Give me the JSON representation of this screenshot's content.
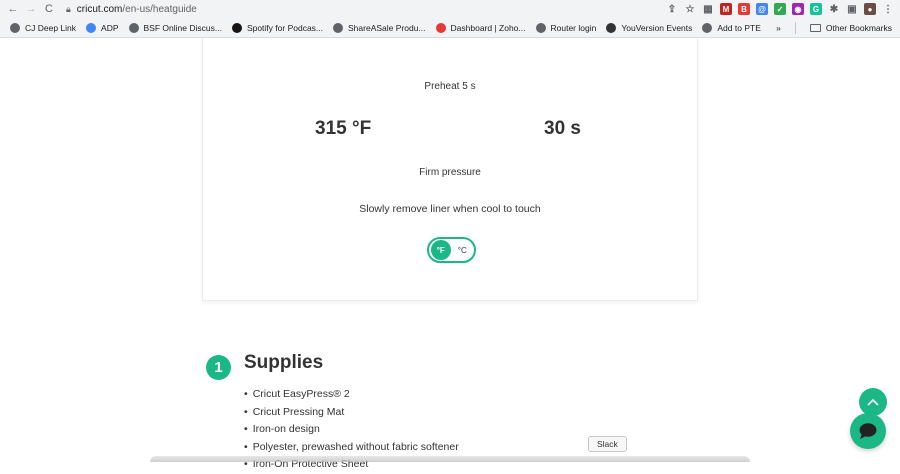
{
  "browser": {
    "url_host": "cricut.com",
    "url_path": "/en-us/heatguide",
    "nav": {
      "back": "←",
      "forward": "→",
      "reload": "C"
    },
    "extensions": [
      {
        "name": "share-icon",
        "glyph": "⇪",
        "color": "#5f6368"
      },
      {
        "name": "star-icon",
        "glyph": "☆",
        "color": "#5f6368"
      },
      {
        "name": "extension-gray-icon",
        "glyph": "▦",
        "color": "#5f6368"
      },
      {
        "name": "extension-red-badge-icon",
        "glyph": "M",
        "color": "#c5221f"
      },
      {
        "name": "extension-red-b-icon",
        "glyph": "B",
        "color": "#e53935"
      },
      {
        "name": "extension-blue-icon",
        "glyph": "@",
        "color": "#4285f4"
      },
      {
        "name": "extension-green-icon",
        "glyph": "✓",
        "color": "#34a853"
      },
      {
        "name": "extension-multi-icon",
        "glyph": "◉",
        "color": "#9c27b0"
      },
      {
        "name": "extension-grammarly-icon",
        "glyph": "G",
        "color": "#15c39a"
      },
      {
        "name": "puzzle-icon",
        "glyph": "✱",
        "color": "#5f6368"
      },
      {
        "name": "sidebar-icon",
        "glyph": "▣",
        "color": "#5f6368"
      },
      {
        "name": "profile-avatar-icon",
        "glyph": "●",
        "color": "#6d4c41"
      },
      {
        "name": "menu-icon",
        "glyph": "⋮",
        "color": "#5f6368"
      }
    ],
    "bookmarks": [
      {
        "label": "CJ Deep Link",
        "icon": "globe-icon",
        "color": "#5f6368"
      },
      {
        "label": "ADP",
        "icon": "doc-icon",
        "color": "#4285f4"
      },
      {
        "label": "BSF Online Discus...",
        "icon": "asterisk-icon",
        "color": "#5f6368"
      },
      {
        "label": "Spotify for Podcas...",
        "icon": "spotify-icon",
        "color": "#191414"
      },
      {
        "label": "ShareASale Produ...",
        "icon": "globe-icon",
        "color": "#5f6368"
      },
      {
        "label": "Dashboard | Zoho...",
        "icon": "zoho-icon",
        "color": "#e53935"
      },
      {
        "label": "Router login",
        "icon": "globe-icon",
        "color": "#5f6368"
      },
      {
        "label": "YouVersion Events",
        "icon": "bible-icon",
        "color": "#333333"
      },
      {
        "label": "Add to PTE",
        "icon": "globe-icon",
        "color": "#5f6368"
      }
    ],
    "overflow": "»",
    "other_bookmarks": "Other Bookmarks"
  },
  "heat_card": {
    "preheat": "Preheat 5 s",
    "temperature": "315 °F",
    "time": "30 s",
    "pressure": "Firm  pressure",
    "instruction": "Slowly remove liner when cool to touch",
    "unit_toggle": {
      "fahrenheit": "°F",
      "celsius": "°C",
      "selected": "°F"
    }
  },
  "supplies": {
    "step_number": "1",
    "title": "Supplies",
    "items": [
      "Cricut EasyPress® 2",
      "Cricut Pressing Mat",
      "Iron-on design",
      "Polyester, prewashed without fabric softener",
      "Iron-On Protective Sheet"
    ]
  },
  "tooltip": "Slack",
  "colors": {
    "accent": "#1bb885"
  }
}
